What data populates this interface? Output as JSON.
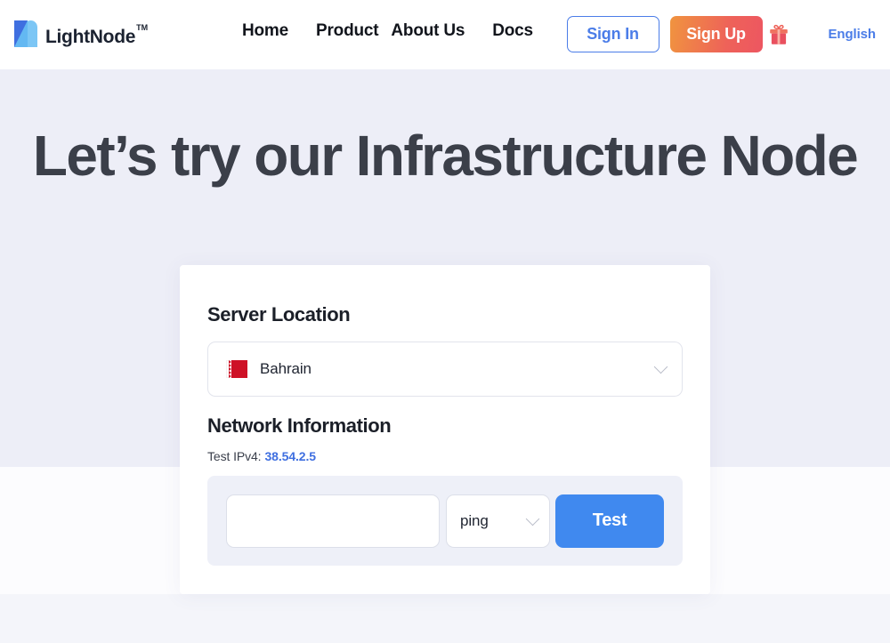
{
  "header": {
    "logo": {
      "text": "LightNode",
      "trademark": "TM",
      "icon": "lightnode-logo-icon"
    },
    "nav": [
      {
        "label": "Home"
      },
      {
        "label": "Product"
      },
      {
        "label": "About Us"
      },
      {
        "label": "Docs"
      }
    ],
    "sign_in_label": "Sign In",
    "sign_up_label": "Sign Up",
    "gift_icon": "gift-icon",
    "language_label": "English",
    "accent_blue": "#4b7de8",
    "signup_gradient_from": "#f0943f",
    "signup_gradient_to": "#ed5661"
  },
  "hero": {
    "title": "Let’s try our Infrastructure Node",
    "background_color": "#edeef7",
    "title_color": "#3b3f49"
  },
  "card": {
    "server_location": {
      "heading": "Server Location",
      "selected_country": "Bahrain",
      "flag_icon": "bahrain-flag-icon",
      "chevron_icon": "chevron-down-icon"
    },
    "network_information": {
      "heading": "Network Information",
      "ip_label": "Test IPv4:",
      "ip_value": "38.54.2.5",
      "ip_color": "#3f6fe0"
    },
    "test_panel": {
      "input_value": "",
      "input_placeholder": "",
      "tool_selected": "ping",
      "tool_chevron_icon": "chevron-down-icon",
      "test_button_label": "Test",
      "test_button_color": "#4089ef",
      "panel_background": "#eef0f8"
    }
  }
}
